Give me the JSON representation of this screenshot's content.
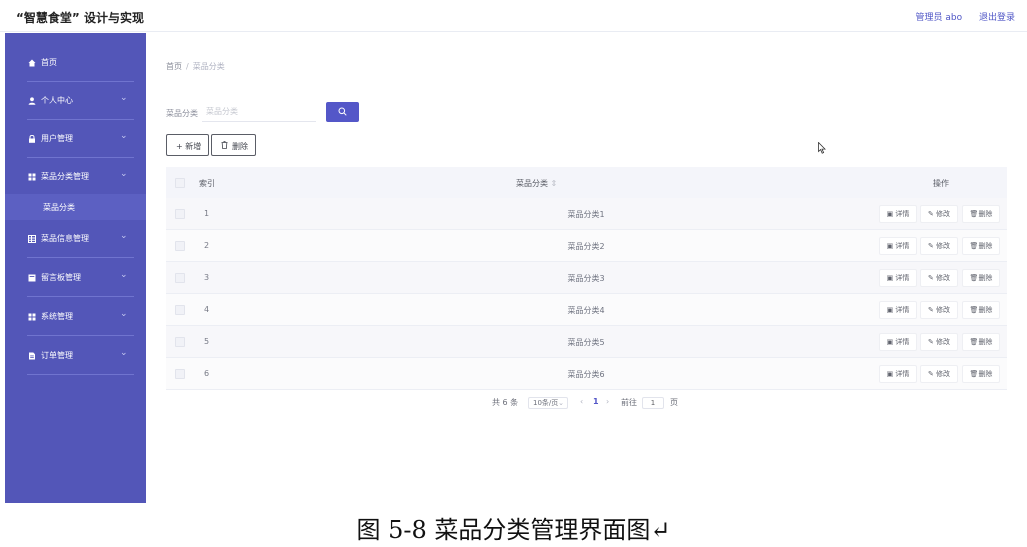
{
  "header": {
    "app_title": "“智慧食堂” 设计与实现",
    "admin_label": "管理员 abo",
    "logout_label": "退出登录"
  },
  "sidebar": {
    "items": [
      {
        "label": "首页",
        "icon": "home-icon",
        "expandable": false
      },
      {
        "label": "个人中心",
        "icon": "user-icon",
        "expandable": true
      },
      {
        "label": "用户管理",
        "icon": "lock-icon",
        "expandable": true
      },
      {
        "label": "菜品分类管理",
        "icon": "grid-icon",
        "expandable": true,
        "expanded": true
      },
      {
        "label": "菜品信息管理",
        "icon": "table-icon",
        "expandable": true
      },
      {
        "label": "留言板管理",
        "icon": "board-icon",
        "expandable": true
      },
      {
        "label": "系统管理",
        "icon": "grid-icon",
        "expandable": true
      },
      {
        "label": "订单管理",
        "icon": "file-icon",
        "expandable": true
      }
    ],
    "sub_item": "菜品分类",
    "colors": {
      "bg": "#5356b8",
      "sub_bg": "#5c60c2"
    }
  },
  "breadcrumb": {
    "home": "首页",
    "separator": "/",
    "current": "菜品分类"
  },
  "search": {
    "label": "菜品分类",
    "placeholder": "菜品分类",
    "value": ""
  },
  "toolbar": {
    "add_label": "+ 新增",
    "delete_label": "删除"
  },
  "table": {
    "headers": {
      "index": "索引",
      "name": "菜品分类",
      "sort_mark": "⇕",
      "actions": "操作"
    },
    "rows": [
      {
        "index": "1",
        "name": "菜品分类1"
      },
      {
        "index": "2",
        "name": "菜品分类2"
      },
      {
        "index": "3",
        "name": "菜品分类3"
      },
      {
        "index": "4",
        "name": "菜品分类4"
      },
      {
        "index": "5",
        "name": "菜品分类5"
      },
      {
        "index": "6",
        "name": "菜品分类6"
      }
    ],
    "row_actions": {
      "detail": "详情",
      "edit": "修改",
      "delete": "删除"
    }
  },
  "pagination": {
    "total_text": "共 6 条",
    "page_size": "10条/页",
    "prev": "‹",
    "current_page": "1",
    "next": "›",
    "goto_label": "前往",
    "goto_value": "1",
    "page_suffix": "页"
  },
  "caption": "图 5-8 菜品分类管理界面图↵",
  "accent_color": "#5457c8"
}
